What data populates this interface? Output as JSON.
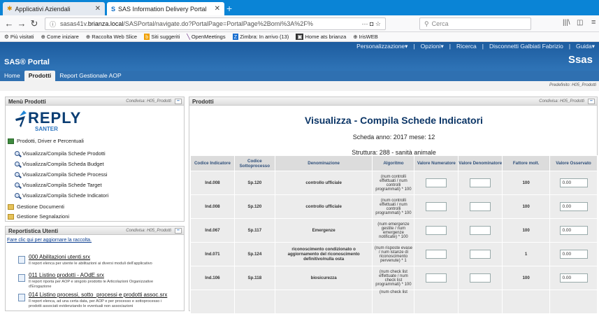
{
  "browser": {
    "tab1_title": "Applicativi Aziendali",
    "tab2_title": "SAS Information Delivery Portal",
    "url_prefix": "sasas41v.",
    "url_domain": "brianza.local",
    "url_rest": "/SASPortal/navigate.do?PortalPage=PortalPage%2Bomi%3A%2F%",
    "url_menu": "···",
    "search_placeholder": "Cerca"
  },
  "bookmarks": [
    "Più visitati",
    "Come iniziare",
    "Raccolta Web Slice",
    "Siti suggeriti",
    "OpenMeetings",
    "Zimbra: In arrivo (13)",
    "Home ats brianza",
    "IrisWEB"
  ],
  "sas": {
    "links": [
      "Personalizzazione▾",
      "|",
      "Opzioni▾",
      "|",
      "Ricerca",
      "|",
      "Disconnetti Galbiati Fabrizio",
      "|",
      "Guida▾"
    ],
    "portal_title": "SAS® Portal",
    "brand": "Ssas",
    "tabs": [
      "Home",
      "Prodotti",
      "Report Gestionale AOP"
    ],
    "preferred": "Predefinito: H05_Prodotti"
  },
  "menu": {
    "title": "Menù Prodotti",
    "shared": "Condivisa: H05_Prodotti",
    "logo_word": "REPLY",
    "logo_sub": "SANTER",
    "group": "Prodotti, Driver e Percentuali",
    "items": [
      "Visualizza/Compila Schede Prodotti",
      "Visualizza/Compila Scheda Budget",
      "Visualizza/Compila Schede Processi",
      "Visualizza/Compila Schede Target",
      "Visualizza/Compila Schede Indicatori"
    ],
    "folders": [
      "Gestione Documenti",
      "Gestione Segnalazioni"
    ]
  },
  "reports": {
    "title": "Reportistica Utenti",
    "shared": "Condivisa: H05_Prodotti",
    "refresh": "Fare clic qui per aggiornare la raccolta.",
    "items": [
      {
        "title": "000 Abilitazioni utenti.srx",
        "desc": "Il report elenca per utente le abilitazioni ai diversi moduli dell'applicativo"
      },
      {
        "title": "011 Listino prodotti - AOdE.srx",
        "desc": "Il report riporta per AOP e singolo prodotto le Articolazioni Organizzative",
        "desc2": "d'Erogazione"
      },
      {
        "title": "014 Listino processi, sotto_processi e prodotti assoc.srx",
        "desc": "Il report elenca, ad una certa data, per AOP e per processo e sottoprocesso i",
        "desc2": "prodotti associati evidenziando le eventuali non associazioni"
      }
    ]
  },
  "products": {
    "title": "Prodotti",
    "shared": "Condivisa: H05_Prodotti",
    "heading": "Visualizza - Compila Schede Indicatori",
    "scheda": "Scheda anno: 2017 mese: 12",
    "struttura": "Struttura: 288 - sanità animale",
    "columns": [
      "Codice Indicatore",
      "Codice Sottoprocesso",
      "Denominazione",
      "Algoritmo",
      "Valore Numeratore",
      "Valore Denominatore",
      "Fattore molt.",
      "Valore Osservato"
    ],
    "rows": [
      {
        "code": "Ind.008",
        "sub": "Sp.120",
        "name": "controllo ufficiale",
        "algo": "(num controlli effettuati / num controlli programmati) * 100",
        "factor": "100",
        "observed": "0.00"
      },
      {
        "code": "Ind.008",
        "sub": "Sp.120",
        "name": "controllo ufficiale",
        "algo": "(num controlli effettuati / num controlli programmati) * 100",
        "factor": "100",
        "observed": "0.00"
      },
      {
        "code": "Ind.067",
        "sub": "Sp.117",
        "name": "Emergenze",
        "algo": "(num emergenze gestite / num emergenze notificate) * 100",
        "factor": "100",
        "observed": "0.00"
      },
      {
        "code": "Ind.071",
        "sub": "Sp.124",
        "name": "riconoscimento condizionato o aggiornamento del riconoscimento definitivo/nulla osta",
        "algo": "(num risposte evase / num istanze di riconoscimento pervenute) * 1",
        "factor": "1",
        "observed": "0.00"
      },
      {
        "code": "Ind.106",
        "sub": "Sp.118",
        "name": "biosicurezza",
        "algo": "(num check list effettuate / num check list programmati) * 100",
        "factor": "100",
        "observed": "0.00"
      },
      {
        "code": "",
        "sub": "",
        "name": "",
        "algo": "(num check list",
        "factor": "",
        "observed": ""
      }
    ]
  }
}
